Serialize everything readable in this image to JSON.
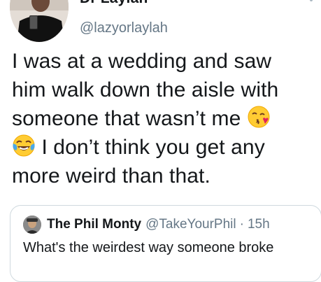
{
  "tweet": {
    "author_name": "Dr Laylah",
    "author_handle": "@lazyorlaylah",
    "more_icon": "more-vertical-icon",
    "lines": [
      "I was at a  wedding and saw",
      "him walk down the aisle with",
      "someone that wasn’t me",
      "I don’t think you get any",
      "more weird than that."
    ],
    "emojis": [
      "face-blowing-kiss-emoji",
      "face-with-tears-of-joy-emoji"
    ]
  },
  "quote": {
    "author_name": "The Phil Monty",
    "author_handle": "@TakeYourPhil",
    "separator": "·",
    "time": "15h",
    "text": "What's the weirdest way someone broke"
  },
  "colors": {
    "text": "#14171a",
    "secondary": "#657786",
    "border": "#cfd9de"
  }
}
